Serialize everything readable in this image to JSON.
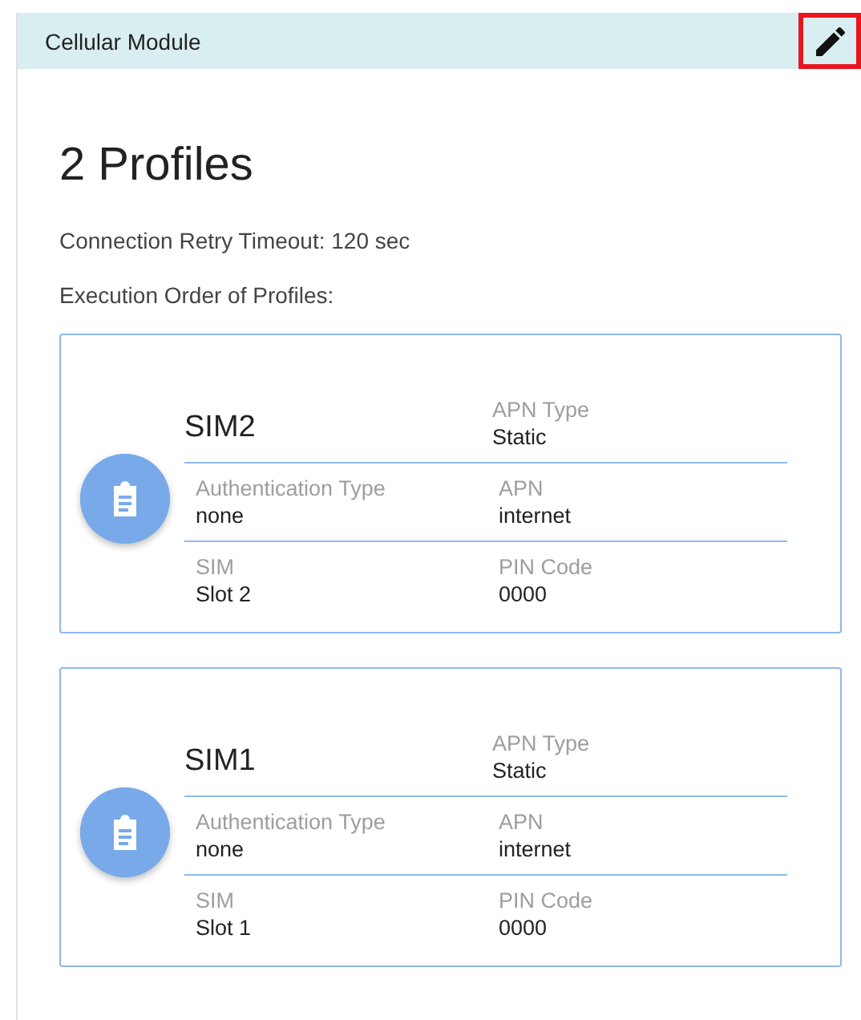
{
  "header": {
    "title": "Cellular Module",
    "highlighted": true
  },
  "heading": "2 Profiles",
  "retry_timeout": "Connection Retry Timeout: 120 sec",
  "order_label": "Execution Order of Profiles:",
  "profiles": [
    {
      "name": "SIM2",
      "apn_type_label": "APN Type",
      "apn_type": "Static",
      "auth_label": "Authentication Type",
      "auth": "none",
      "apn_label": "APN",
      "apn": "internet",
      "sim_label": "SIM",
      "sim": "Slot 2",
      "pin_label": "PIN Code",
      "pin": "0000"
    },
    {
      "name": "SIM1",
      "apn_type_label": "APN Type",
      "apn_type": "Static",
      "auth_label": "Authentication Type",
      "auth": "none",
      "apn_label": "APN",
      "apn": "internet",
      "sim_label": "SIM",
      "sim": "Slot 1",
      "pin_label": "PIN Code",
      "pin": "0000"
    }
  ]
}
